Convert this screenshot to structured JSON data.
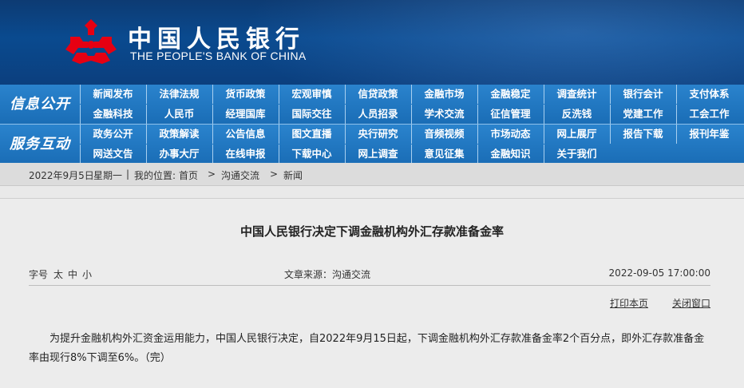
{
  "header": {
    "title_cn": "中国人民银行",
    "title_en": "THE PEOPLE'S BANK OF CHINA",
    "logo_color": "#e60012"
  },
  "nav": {
    "group1": {
      "label": "信息公开",
      "row1": [
        "新闻发布",
        "法律法规",
        "货币政策",
        "宏观审慎",
        "信贷政策",
        "金融市场",
        "金融稳定",
        "调查统计",
        "银行会计",
        "支付体系"
      ],
      "row2": [
        "金融科技",
        "人民币",
        "经理国库",
        "国际交往",
        "人员招录",
        "学术交流",
        "征信管理",
        "反洗钱",
        "党建工作",
        "工会工作"
      ]
    },
    "group2": {
      "label": "服务互动",
      "row1": [
        "政务公开",
        "政策解读",
        "公告信息",
        "图文直播",
        "央行研究",
        "音频视频",
        "市场动态",
        "网上展厅",
        "报告下载",
        "报刊年鉴"
      ],
      "row2": [
        "网送文告",
        "办事大厅",
        "在线申报",
        "下载中心",
        "网上调查",
        "意见征集",
        "金融知识",
        "关于我们"
      ]
    }
  },
  "breadcrumb": {
    "date": "2022年9月5日",
    "weekday": "星期一",
    "sep": "|",
    "location_label": "我的位置:",
    "home": "首页",
    "arrow1": ">",
    "level1": "沟通交流",
    "arrow2": ">",
    "level2": "新闻"
  },
  "article": {
    "title": "中国人民银行决定下调金融机构外汇存款准备金率",
    "font_size_label": "字号",
    "font_large": "太",
    "font_medium": "中",
    "font_small": "小",
    "source": "文章来源：沟通交流",
    "datetime": "2022-09-05 17:00:00",
    "print": "打印本页",
    "close": "关闭窗口",
    "body": "为提升金融机构外汇资金运用能力，中国人民银行决定，自2022年9月15日起，下调金融机构外汇存款准备金率2个百分点，即外汇存款准备金率由现行8%下调至6%。（完）"
  }
}
